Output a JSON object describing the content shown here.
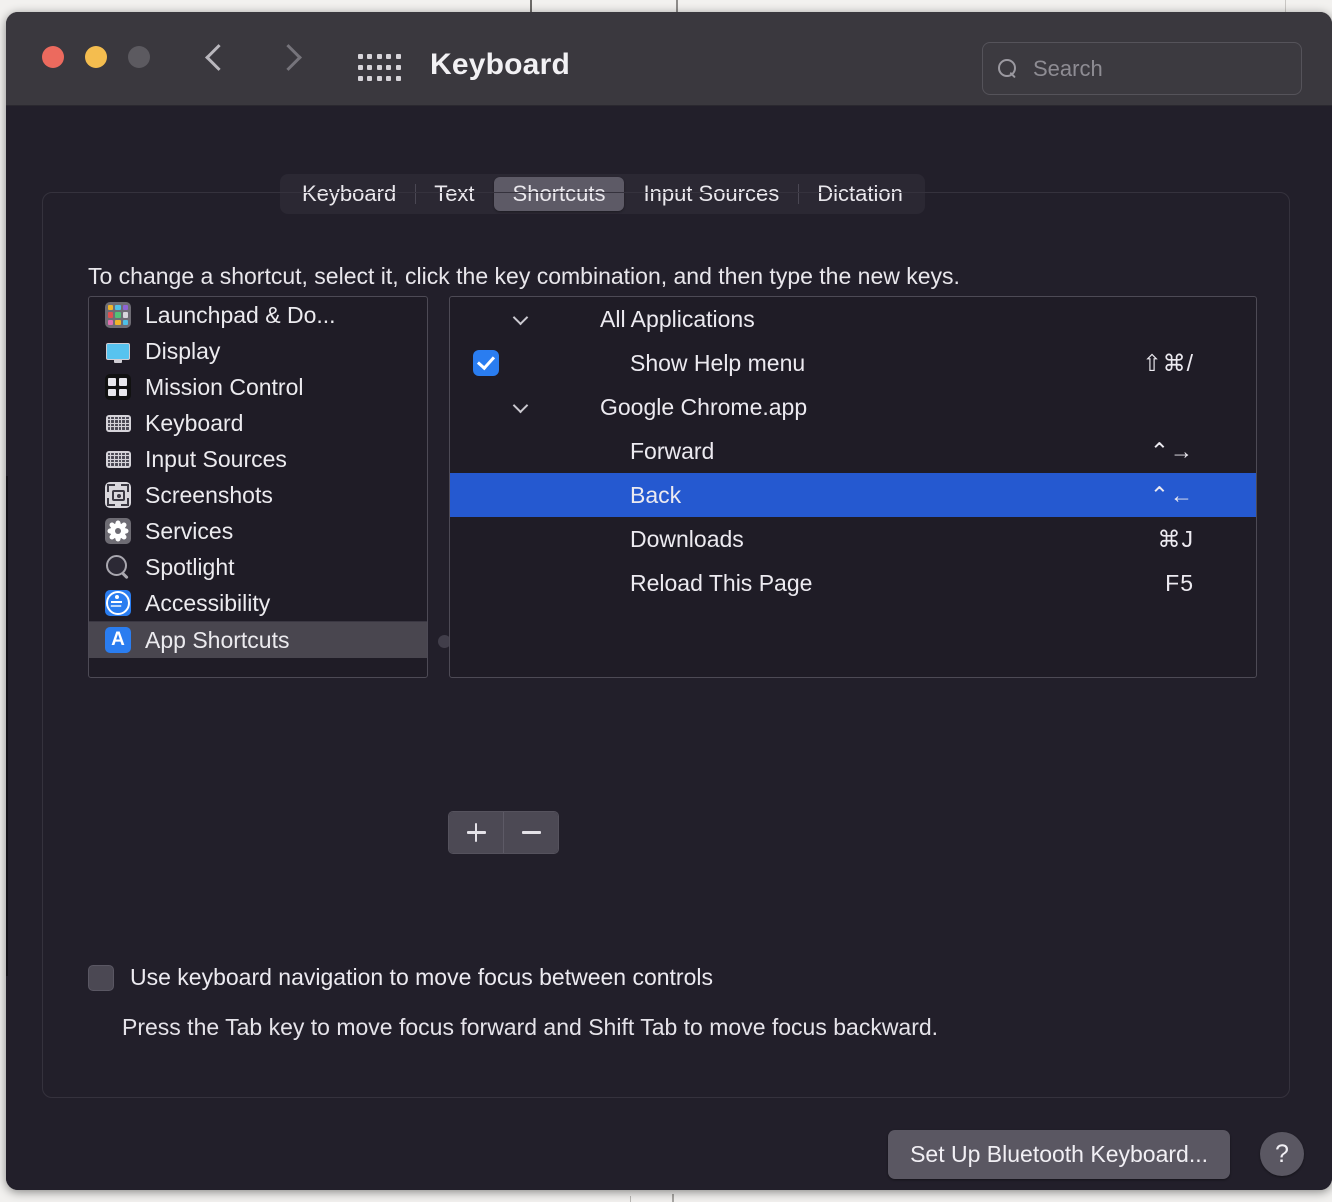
{
  "window": {
    "title": "Keyboard",
    "traffic_lights": [
      "close-button",
      "minimize-button",
      "zoom-button"
    ],
    "back_label": "chevron-left-icon",
    "forward_label": "chevron-right-icon",
    "grid_label": "grid-view-icon"
  },
  "search": {
    "placeholder": "Search",
    "value": ""
  },
  "tabs": [
    {
      "label": "Keyboard",
      "active": false
    },
    {
      "label": "Text",
      "active": false
    },
    {
      "label": "Shortcuts",
      "active": true
    },
    {
      "label": "Input Sources",
      "active": false
    },
    {
      "label": "Dictation",
      "active": false
    }
  ],
  "hint": "To change a shortcut, select it, click the key combination, and then type the new keys.",
  "sidebar": {
    "items": [
      {
        "label": "Launchpad & Do...",
        "icon": "launchpad-icon",
        "selected": false
      },
      {
        "label": "Display",
        "icon": "display-icon",
        "selected": false
      },
      {
        "label": "Mission Control",
        "icon": "mission-control-icon",
        "selected": false
      },
      {
        "label": "Keyboard",
        "icon": "keyboard-icon",
        "selected": false
      },
      {
        "label": "Input Sources",
        "icon": "input-sources-icon",
        "selected": false
      },
      {
        "label": "Screenshots",
        "icon": "screenshots-icon",
        "selected": false
      },
      {
        "label": "Services",
        "icon": "services-gear-icon",
        "selected": false
      },
      {
        "label": "Spotlight",
        "icon": "spotlight-magnifier-icon",
        "selected": false
      },
      {
        "label": "Accessibility",
        "icon": "accessibility-icon",
        "selected": false
      },
      {
        "label": "App Shortcuts",
        "icon": "app-shortcuts-icon",
        "selected": true
      }
    ]
  },
  "shortcuts": {
    "rows": [
      {
        "type": "group",
        "label": "All Applications",
        "expanded": true
      },
      {
        "type": "item",
        "label": "Show Help menu",
        "key": "⇧⌘/",
        "checked": true,
        "selected": false
      },
      {
        "type": "group",
        "label": "Google Chrome.app",
        "expanded": true
      },
      {
        "type": "item",
        "label": "Forward",
        "key": "⌃→",
        "checked": false,
        "selected": false
      },
      {
        "type": "item",
        "label": "Back",
        "key": "⌃←",
        "checked": false,
        "selected": true
      },
      {
        "type": "item",
        "label": "Downloads",
        "key": "⌘J",
        "checked": false,
        "selected": false
      },
      {
        "type": "item",
        "label": "Reload This Page",
        "key": "F5",
        "checked": false,
        "selected": false
      }
    ],
    "add_label": "+",
    "remove_label": "−"
  },
  "keyboard_nav": {
    "checkbox_label": "Use keyboard navigation to move focus between controls",
    "checked": false,
    "sub_label": "Press the Tab key to move focus forward and Shift Tab to move focus backward."
  },
  "footer": {
    "bluetooth_button": "Set Up Bluetooth Keyboard...",
    "help_button": "?"
  },
  "colors": {
    "selection_blue": "#2559d0",
    "checkbox_blue": "#2a7df0",
    "window_bg": "#221f2a",
    "titlebar_bg": "#3a383e",
    "close": "#ec6a5e",
    "minimize": "#f4bd4f",
    "zoom": "#5c5a60"
  }
}
